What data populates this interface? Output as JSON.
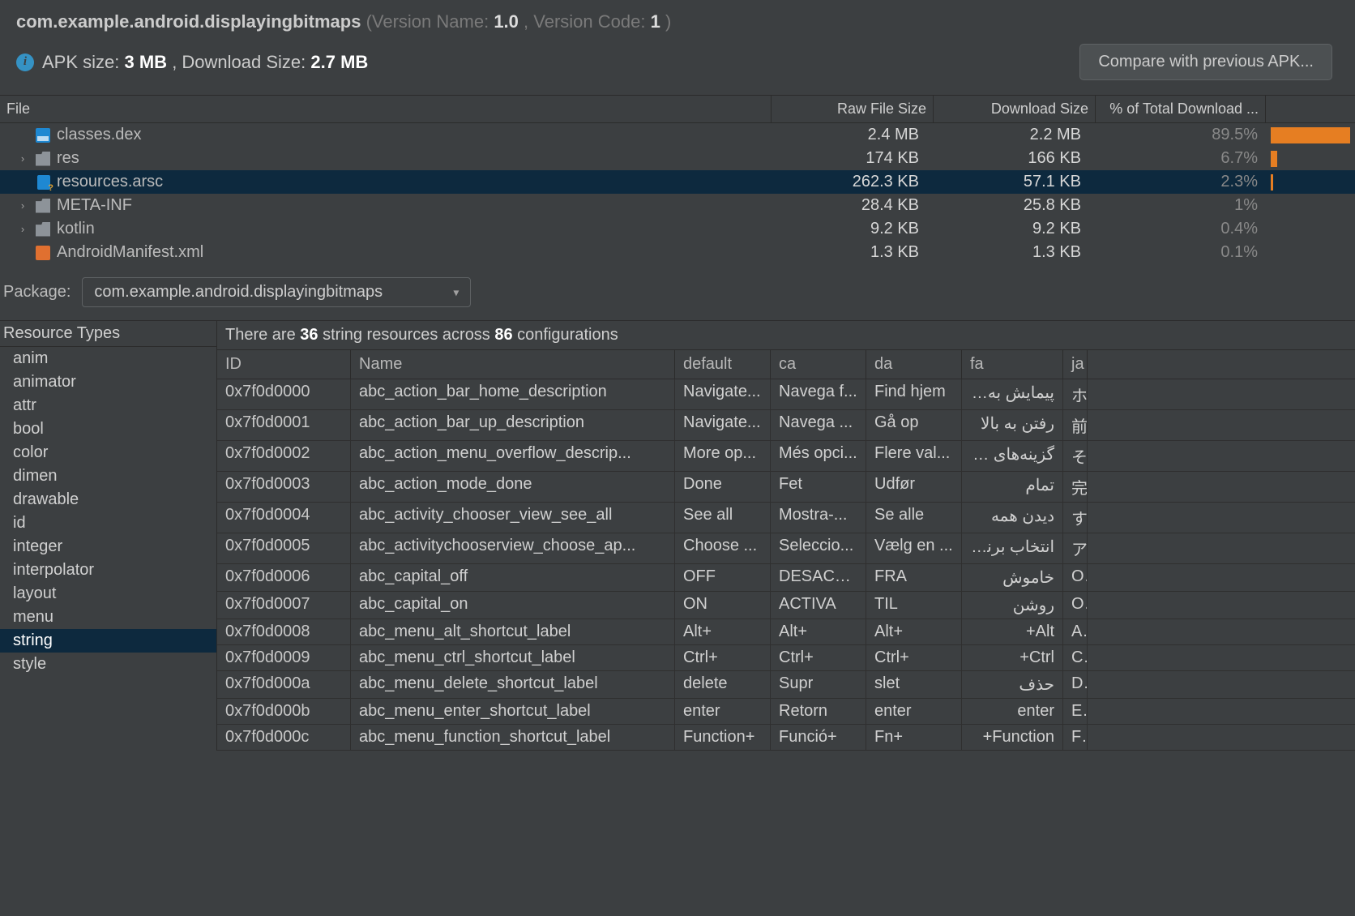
{
  "header": {
    "package_name": "com.example.android.displayingbitmaps",
    "version_name_label": "(Version Name:",
    "version_name": "1.0",
    "version_code_label": ", Version Code:",
    "version_code": "1",
    "paren_close": ")",
    "apk_size_label": "APK size:",
    "apk_size": "3 MB",
    "download_size_label": ", Download Size:",
    "download_size": "2.7 MB",
    "compare_button": "Compare with previous APK..."
  },
  "file_table": {
    "headers": {
      "file": "File",
      "raw": "Raw File Size",
      "dl": "Download Size",
      "pct": "% of Total Download ..."
    },
    "rows": [
      {
        "name": "classes.dex",
        "icon": "dex",
        "disc": "",
        "raw": "2.4 MB",
        "dl": "2.2 MB",
        "pct": "89.5%",
        "bar": 100,
        "selected": false
      },
      {
        "name": "res",
        "icon": "foldery",
        "disc": "›",
        "raw": "174 KB",
        "dl": "166 KB",
        "pct": "6.7%",
        "bar": 8,
        "selected": false
      },
      {
        "name": "resources.arsc",
        "icon": "arsc",
        "disc": "",
        "raw": "262.3 KB",
        "dl": "57.1 KB",
        "pct": "2.3%",
        "bar": 3,
        "selected": true
      },
      {
        "name": "META-INF",
        "icon": "folder",
        "disc": "›",
        "raw": "28.4 KB",
        "dl": "25.8 KB",
        "pct": "1%",
        "bar": 0,
        "selected": false
      },
      {
        "name": "kotlin",
        "icon": "folder",
        "disc": "›",
        "raw": "9.2 KB",
        "dl": "9.2 KB",
        "pct": "0.4%",
        "bar": 0,
        "selected": false
      },
      {
        "name": "AndroidManifest.xml",
        "icon": "xml",
        "disc": "",
        "raw": "1.3 KB",
        "dl": "1.3 KB",
        "pct": "0.1%",
        "bar": 0,
        "selected": false
      }
    ]
  },
  "package_row": {
    "label": "Package:",
    "value": "com.example.android.displayingbitmaps"
  },
  "resource_types": {
    "header": "Resource Types",
    "items": [
      "anim",
      "animator",
      "attr",
      "bool",
      "color",
      "dimen",
      "drawable",
      "id",
      "integer",
      "interpolator",
      "layout",
      "menu",
      "string",
      "style"
    ],
    "selected": "string"
  },
  "string_panel": {
    "summary_pre": "There are ",
    "count": "36",
    "summary_mid": " string resources across ",
    "configs": "86",
    "summary_post": " configurations",
    "headers": {
      "id": "ID",
      "name": "Name",
      "default": "default",
      "ca": "ca",
      "da": "da",
      "fa": "fa",
      "ja": "ja"
    },
    "rows": [
      {
        "id": "0x7f0d0000",
        "name": "abc_action_bar_home_description",
        "default": "Navigate...",
        "ca": "Navega f...",
        "da": "Find hjem",
        "fa": "پیمایش به ...",
        "ja": "ホ"
      },
      {
        "id": "0x7f0d0001",
        "name": "abc_action_bar_up_description",
        "default": "Navigate...",
        "ca": "Navega ...",
        "da": "Gå op",
        "fa": "رفتن به بالا",
        "ja": "前"
      },
      {
        "id": "0x7f0d0002",
        "name": "abc_action_menu_overflow_descrip...",
        "default": "More op...",
        "ca": "Més opci...",
        "da": "Flere val...",
        "fa": "گزینه‌های بی...",
        "ja": "そ"
      },
      {
        "id": "0x7f0d0003",
        "name": "abc_action_mode_done",
        "default": "Done",
        "ca": "Fet",
        "da": "Udfør",
        "fa": "تمام",
        "ja": "完"
      },
      {
        "id": "0x7f0d0004",
        "name": "abc_activity_chooser_view_see_all",
        "default": "See all",
        "ca": "Mostra-...",
        "da": "Se alle",
        "fa": "دیدن همه",
        "ja": "す"
      },
      {
        "id": "0x7f0d0005",
        "name": "abc_activitychooserview_choose_ap...",
        "default": "Choose ...",
        "ca": "Seleccio...",
        "da": "Vælg en ...",
        "fa": "انتخاب برنامه",
        "ja": "ア"
      },
      {
        "id": "0x7f0d0006",
        "name": "abc_capital_off",
        "default": "OFF",
        "ca": "DESACTI...",
        "da": "FRA",
        "fa": "خاموش",
        "ja": "OI"
      },
      {
        "id": "0x7f0d0007",
        "name": "abc_capital_on",
        "default": "ON",
        "ca": "ACTIVA",
        "da": "TIL",
        "fa": "روشن",
        "ja": "OI"
      },
      {
        "id": "0x7f0d0008",
        "name": "abc_menu_alt_shortcut_label",
        "default": "Alt+",
        "ca": "Alt+",
        "da": "Alt+",
        "fa": "Alt+",
        "ja": "Al"
      },
      {
        "id": "0x7f0d0009",
        "name": "abc_menu_ctrl_shortcut_label",
        "default": "Ctrl+",
        "ca": "Ctrl+",
        "da": "Ctrl+",
        "fa": "Ctrl+",
        "ja": "Ct"
      },
      {
        "id": "0x7f0d000a",
        "name": "abc_menu_delete_shortcut_label",
        "default": "delete",
        "ca": "Supr",
        "da": "slet",
        "fa": "حذف",
        "ja": "De"
      },
      {
        "id": "0x7f0d000b",
        "name": "abc_menu_enter_shortcut_label",
        "default": "enter",
        "ca": "Retorn",
        "da": "enter",
        "fa": "enter",
        "ja": "Er"
      },
      {
        "id": "0x7f0d000c",
        "name": "abc_menu_function_shortcut_label",
        "default": "Function+",
        "ca": "Funció+",
        "da": "Fn+",
        "fa": "Function+",
        "ja": "Fu"
      }
    ]
  }
}
